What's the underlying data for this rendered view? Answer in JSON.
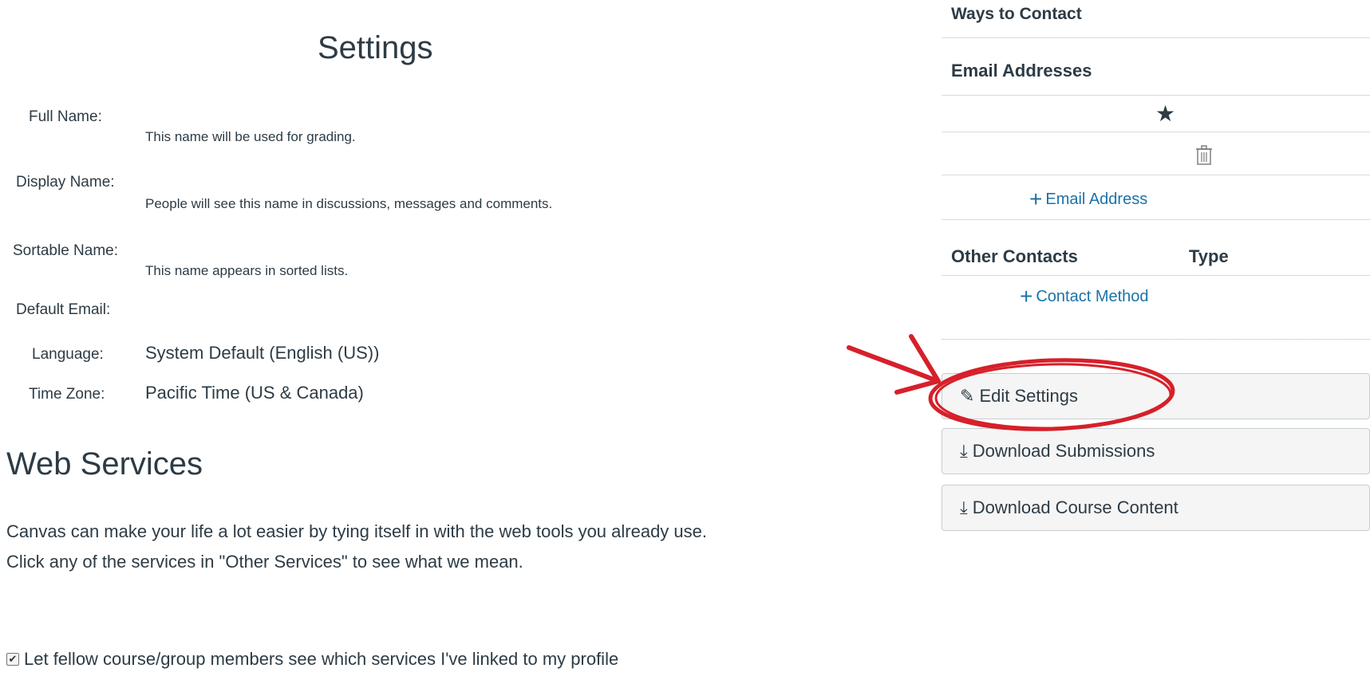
{
  "settings": {
    "title": "Settings",
    "fields": [
      {
        "label": "Full Name:",
        "hint": "This name will be used for grading."
      },
      {
        "label": "Display Name:",
        "hint": "People will see this name in discussions, messages and comments."
      },
      {
        "label": "Sortable Name:",
        "hint": "This name appears in sorted lists."
      },
      {
        "label": "Default Email:"
      },
      {
        "label": "Language:",
        "value": "System Default (English (US))"
      },
      {
        "label": "Time Zone:",
        "value": "Pacific Time (US & Canada)"
      }
    ]
  },
  "web_services": {
    "title": "Web Services",
    "description_line1": "Canvas can make your life a lot easier by tying itself in with the web tools you already use.",
    "description_line2": "Click any of the services in \"Other Services\" to see what we mean.",
    "checkbox_label": "Let fellow course/group members see which services I've linked to my profile",
    "checkbox_checked": true
  },
  "sidebar": {
    "ways_to_contact": "Ways to Contact",
    "email_addresses": "Email Addresses",
    "add_email": "Email Address",
    "other_contacts": "Other Contacts",
    "type_header": "Type",
    "add_contact_method": "Contact Method",
    "buttons": {
      "edit_settings": "Edit Settings",
      "download_submissions": "Download Submissions",
      "download_course_content": "Download Course Content"
    }
  },
  "colors": {
    "link": "#1a73a8",
    "text": "#2d3b45",
    "annotation": "#d6202a",
    "button_bg": "#f5f5f5"
  },
  "icons": {
    "primary_email": "star-icon",
    "delete_email": "trash-icon",
    "add": "plus-icon",
    "edit": "pencil-icon",
    "download": "download-icon"
  }
}
